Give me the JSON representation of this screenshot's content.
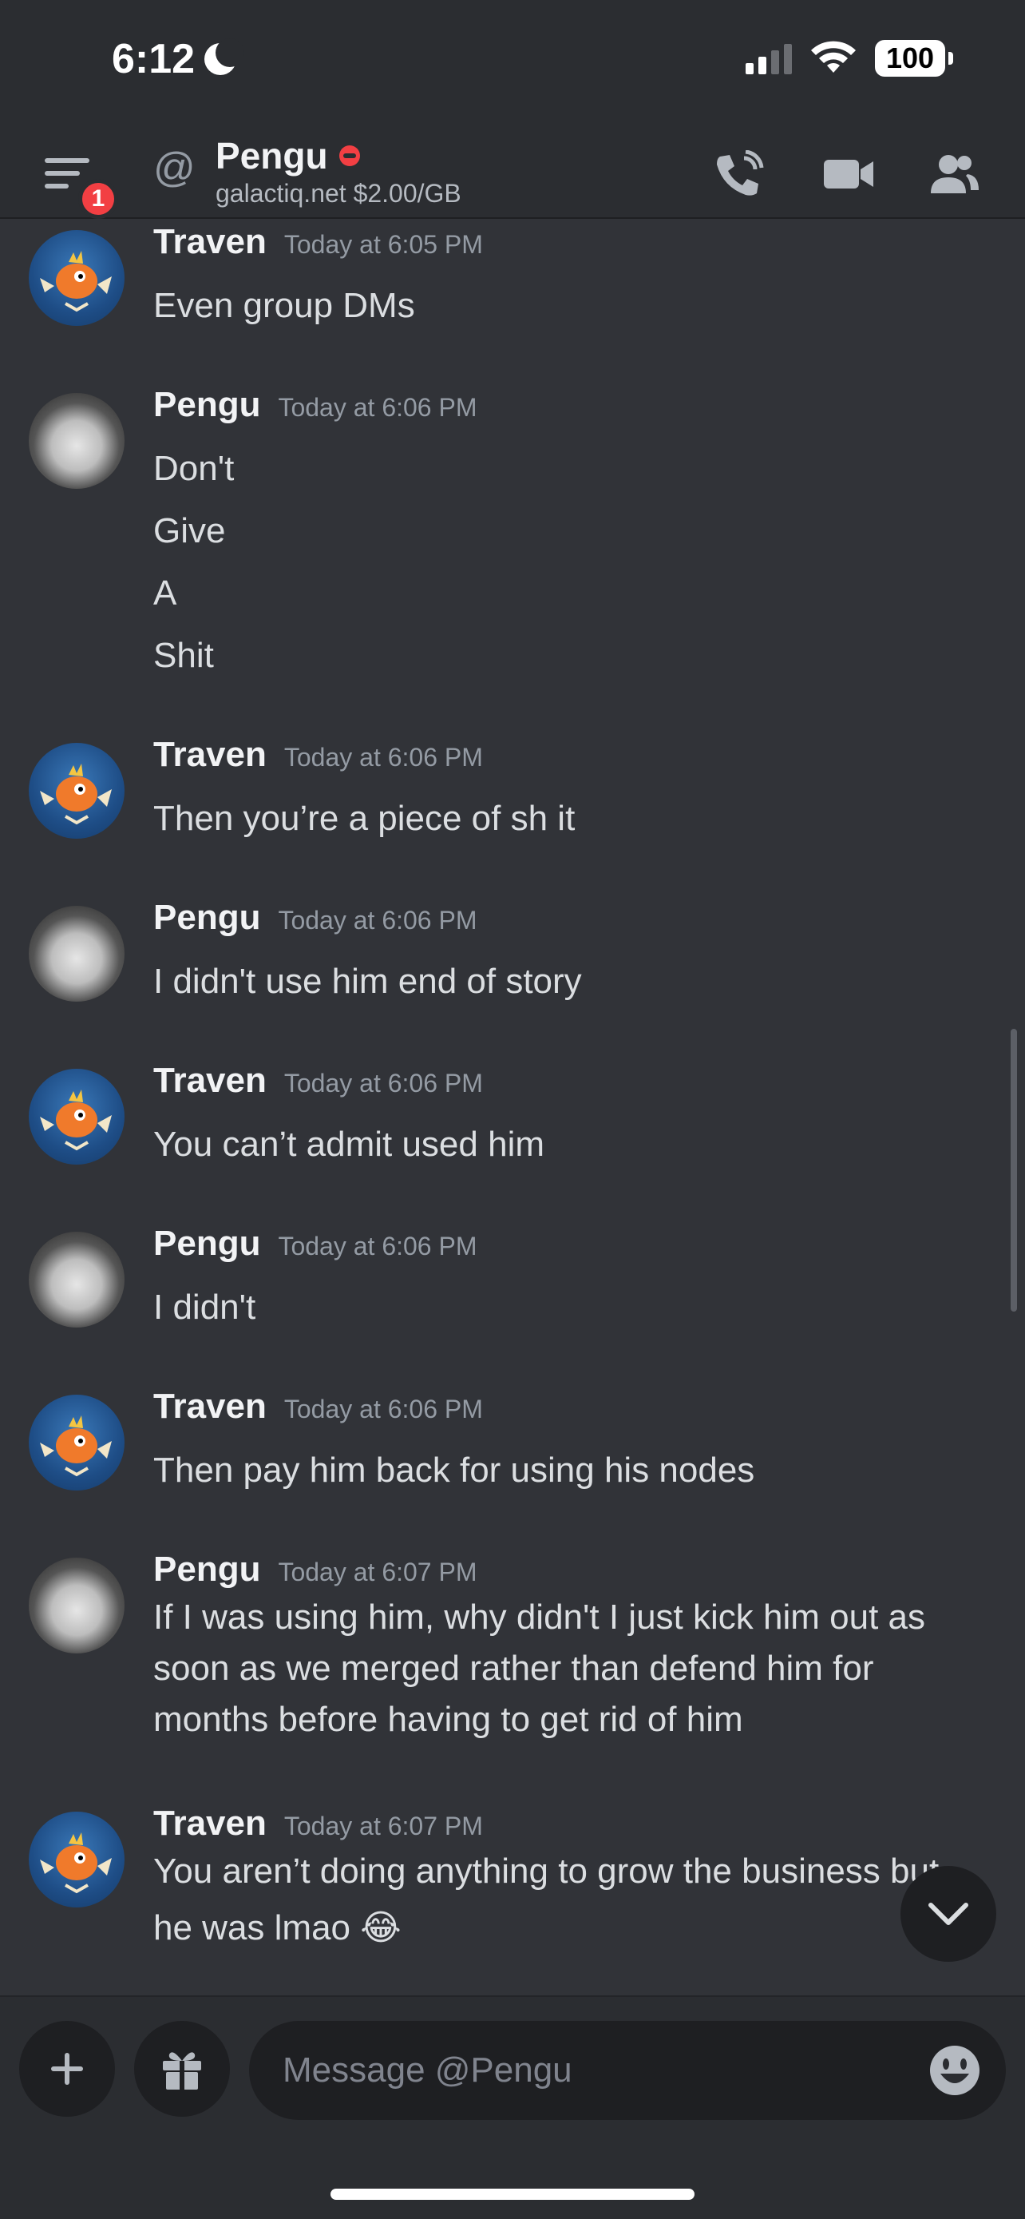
{
  "status_bar": {
    "time": "6:12",
    "battery": "100"
  },
  "header": {
    "notification_count": "1",
    "at_symbol": "@",
    "title": "Pengu",
    "subtitle": "galactiq.net $2.00/GB"
  },
  "messages": [
    {
      "author": "Traven",
      "time": "Today at 6:05 PM",
      "lines": [
        "Even group DMs"
      ]
    },
    {
      "author": "Pengu",
      "time": "Today at 6:06 PM",
      "lines": [
        "Don't",
        "Give",
        "A",
        "Shit"
      ]
    },
    {
      "author": "Traven",
      "time": "Today at 6:06 PM",
      "lines": [
        "Then you’re a piece of sh it"
      ]
    },
    {
      "author": "Pengu",
      "time": "Today at 6:06 PM",
      "lines": [
        "I didn't use him end of story"
      ]
    },
    {
      "author": "Traven",
      "time": "Today at 6:06 PM",
      "lines": [
        "You can’t admit used him"
      ]
    },
    {
      "author": "Pengu",
      "time": "Today at 6:06 PM",
      "lines": [
        "I didn't"
      ]
    },
    {
      "author": "Traven",
      "time": "Today at 6:06 PM",
      "lines": [
        "Then pay him back for using his nodes"
      ]
    },
    {
      "author": "Pengu",
      "time": "Today at 6:07 PM",
      "lines": [
        "If I was using him, why didn't I just kick him out as",
        "soon as we merged rather than defend him for",
        "months before having to get rid of him"
      ]
    },
    {
      "author": "Traven",
      "time": "Today at 6:07 PM",
      "lines": [
        "You aren’t doing anything to grow the business but",
        "he was lmao 😂"
      ]
    }
  ],
  "composer": {
    "placeholder": "Message @Pengu"
  },
  "colors": {
    "background": "#313338",
    "header_bg": "#2b2d31",
    "input_bg": "#1e1f22",
    "danger": "#f23f43",
    "text": "#dbdee1",
    "muted": "#949ba4"
  }
}
